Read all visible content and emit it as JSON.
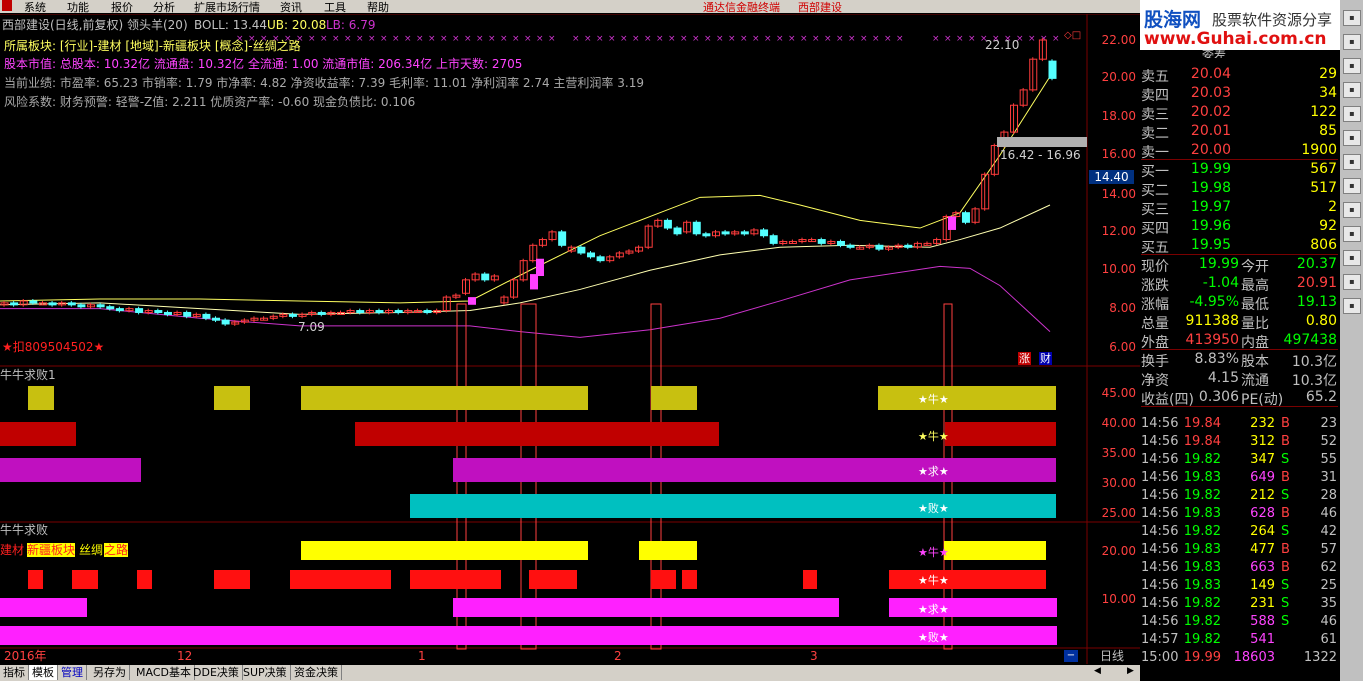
{
  "menu": {
    "items": [
      "系统",
      "功能",
      "报价",
      "分析",
      "扩展市场行情",
      "资讯",
      "工具",
      "帮助"
    ],
    "center_a": "通达信金融终端",
    "center_b": "西部建设"
  },
  "logo": {
    "text_a": "股海网",
    "text_b": "股票软件资源分享",
    "url": "www.Guhai.com.cn"
  },
  "chart": {
    "title": "西部建设(日线,前复权) 领头羊(20)",
    "boll_label": "BOLL: 13.44",
    "ub_label": "UB: 20.08",
    "lb_label": "LB: 6.79",
    "info1": "所属板块: [行业]-建材 [地域]-新疆板块 [概念]-丝绸之路",
    "info2": "股本市值: 总股本: 10.32亿 流通盘: 10.32亿 全流通: 1.00 流通市值: 206.34亿 上市天数: 2705",
    "info3": "当前业绩: 市盈率: 65.23 市销率: 1.79 市净率: 4.82 净资收益率: 7.39 毛利率: 11.01 净利润率 2.74 主营利润率 3.19",
    "info4": "风险系数: 财务预警: 轻警-Z值: 2.211 优质资产率: -0.60 现金负债比: 0.106",
    "high_label": "22.10",
    "low_label": "7.09",
    "gray_label": "16.42 - 16.96",
    "phone": "★扣809504502★",
    "tag_zhang": "涨",
    "tag_cai": "财",
    "price_tag": "14.40",
    "y_ticks": [
      "22.00",
      "20.00",
      "18.00",
      "16.00",
      "14.00",
      "12.00",
      "10.00",
      "8.00",
      "6.00"
    ],
    "x_labels": [
      "2016年",
      "12",
      "1",
      "2",
      "3"
    ],
    "period": "日线",
    "colors": {
      "up": "#ff3c3c",
      "down": "#54ffff",
      "boll_mid": "#ffffb0",
      "boll_ub": "#ffff60",
      "boll_lb": "#cc33cc"
    }
  },
  "panel1": {
    "title": "牛牛求败1",
    "y_ticks": [
      "45.00",
      "40.00",
      "35.00",
      "30.00",
      "25.00"
    ],
    "labels": [
      "★牛★",
      "★牛★",
      "★求★",
      "★败★"
    ]
  },
  "panel2": {
    "title": "牛牛求败",
    "tags": [
      "建材",
      "新疆板块",
      "丝绸",
      "之路"
    ],
    "y_ticks": [
      "20.00",
      "10.00"
    ],
    "labels": [
      "★牛★",
      "★牛★",
      "★求★",
      "★败★"
    ]
  },
  "bottom_tabs": [
    "指标",
    "模板",
    "管理",
    "另存为",
    "MACD基本",
    "DDE决策",
    "SUP决策",
    "资金决策"
  ],
  "quote": {
    "header_partial": "委差",
    "asks": [
      {
        "l": "卖五",
        "p": "20.04",
        "v": "29"
      },
      {
        "l": "卖四",
        "p": "20.03",
        "v": "34"
      },
      {
        "l": "卖三",
        "p": "20.02",
        "v": "122"
      },
      {
        "l": "卖二",
        "p": "20.01",
        "v": "85"
      },
      {
        "l": "卖一",
        "p": "20.00",
        "v": "1900"
      }
    ],
    "bids": [
      {
        "l": "买一",
        "p": "19.99",
        "v": "567"
      },
      {
        "l": "买二",
        "p": "19.98",
        "v": "517"
      },
      {
        "l": "买三",
        "p": "19.97",
        "v": "2"
      },
      {
        "l": "买四",
        "p": "19.96",
        "v": "92"
      },
      {
        "l": "买五",
        "p": "19.95",
        "v": "806"
      }
    ],
    "stats": [
      {
        "a": "现价",
        "av": "19.99",
        "b": "今开",
        "bv": "20.37",
        "ac": "#00ff00",
        "bc": "#00ff00"
      },
      {
        "a": "涨跌",
        "av": "-1.04",
        "b": "最高",
        "bv": "20.91",
        "ac": "#00ff00",
        "bc": "#ff4040"
      },
      {
        "a": "涨幅",
        "av": "-4.95%",
        "b": "最低",
        "bv": "19.13",
        "ac": "#00ff00",
        "bc": "#00ff00"
      },
      {
        "a": "总量",
        "av": "911388",
        "b": "量比",
        "bv": "0.80",
        "ac": "#ffff00",
        "bc": "#ffff00"
      },
      {
        "a": "外盘",
        "av": "413950",
        "b": "内盘",
        "bv": "497438",
        "ac": "#ff4040",
        "bc": "#00ff00"
      }
    ],
    "stats2": [
      {
        "a": "换手",
        "av": "8.83%",
        "b": "股本",
        "bv": "10.3亿"
      },
      {
        "a": "净资",
        "av": "4.15",
        "b": "流通",
        "bv": "10.3亿"
      },
      {
        "a": "收益(四)",
        "av": "0.306",
        "b": "PE(动)",
        "bv": "65.2"
      }
    ],
    "ticks": [
      {
        "t": "14:56",
        "p": "19.84",
        "v": "232",
        "bs": "B",
        "n": "23"
      },
      {
        "t": "14:56",
        "p": "19.84",
        "v": "312",
        "bs": "B",
        "n": "52"
      },
      {
        "t": "14:56",
        "p": "19.82",
        "v": "347",
        "bs": "S",
        "n": "55"
      },
      {
        "t": "14:56",
        "p": "19.83",
        "v": "649",
        "bs": "B",
        "n": "31"
      },
      {
        "t": "14:56",
        "p": "19.82",
        "v": "212",
        "bs": "S",
        "n": "28"
      },
      {
        "t": "14:56",
        "p": "19.83",
        "v": "628",
        "bs": "B",
        "n": "46"
      },
      {
        "t": "14:56",
        "p": "19.82",
        "v": "264",
        "bs": "S",
        "n": "42"
      },
      {
        "t": "14:56",
        "p": "19.83",
        "v": "477",
        "bs": "B",
        "n": "57"
      },
      {
        "t": "14:56",
        "p": "19.83",
        "v": "663",
        "bs": "B",
        "n": "62"
      },
      {
        "t": "14:56",
        "p": "19.83",
        "v": "149",
        "bs": "S",
        "n": "25"
      },
      {
        "t": "14:56",
        "p": "19.82",
        "v": "231",
        "bs": "S",
        "n": "35"
      },
      {
        "t": "14:56",
        "p": "19.82",
        "v": "588",
        "bs": "S",
        "n": "46"
      },
      {
        "t": "14:57",
        "p": "19.82",
        "v": "541",
        "bs": "",
        "n": "61"
      },
      {
        "t": "15:00",
        "p": "19.99",
        "v": "18603",
        "bs": "",
        "n": "1322"
      }
    ]
  },
  "toolbar_icons": [
    "chart-icon",
    "grid-icon",
    "list-icon",
    "info-icon",
    "bar-icon",
    "candle-icon",
    "f10-icon",
    "f9-icon",
    "rsi-icon",
    "arrow-icon",
    "move-icon",
    "pen-icon",
    "zoom-icon"
  ]
}
